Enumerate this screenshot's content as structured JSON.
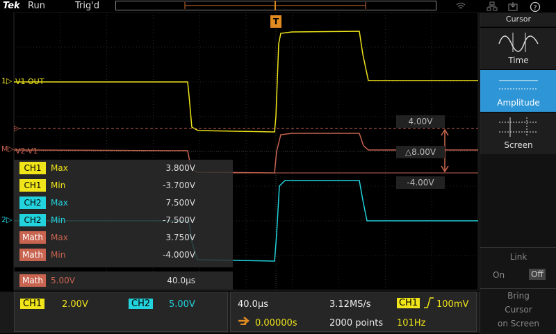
{
  "topbar": {
    "brand": "Tek",
    "run_state": "Run",
    "trigger_state": "Trig'd"
  },
  "colors": {
    "ch1": "#f0e41a",
    "ch2": "#22d3dd",
    "math": "#c86450",
    "panel_selected": "#2e96d6"
  },
  "icons": [
    "wifi-icon",
    "network-icon",
    "save-icon",
    "help-icon",
    "trigger-position-icon"
  ],
  "scope": {
    "ch1_label": "V1 OUT",
    "ch1_marker": "1",
    "ch2_marker": "2",
    "math_marker": "M",
    "math_label": "V2-V1",
    "trigger_label": "T",
    "cursor_top": "4.00V",
    "cursor_delta": "△8.00V",
    "cursor_bottom": "-4.00V"
  },
  "measurements": [
    {
      "source": "CH1",
      "name": "Max",
      "value": "3.800V"
    },
    {
      "source": "CH1",
      "name": "Min",
      "value": "-3.700V"
    },
    {
      "source": "CH2",
      "name": "Max",
      "value": "7.500V"
    },
    {
      "source": "CH2",
      "name": "Min",
      "value": "-7.500V"
    },
    {
      "source": "Math",
      "name": "Max",
      "value": "3.750V"
    },
    {
      "source": "Math",
      "name": "Min",
      "value": "-4.000V"
    }
  ],
  "math_setting": {
    "source": "Math",
    "scale": "5.00V",
    "time": "40.0µs"
  },
  "bottombar": {
    "ch1_label": "CH1",
    "ch1_scale": "2.00V",
    "ch2_label": "CH2",
    "ch2_scale": "5.00V",
    "horizontal_scale": "40.0µs",
    "sample_rate": "3.12MS/s",
    "trigger_source": "CH1",
    "trigger_level": "100mV",
    "position": "0.00000s",
    "record_length": "2000 points",
    "frequency": "101Hz"
  },
  "panel": {
    "title": "Cursor",
    "buttons": [
      {
        "label": "Time",
        "icon": "time-cursor-icon",
        "selected": false
      },
      {
        "label": "Amplitude",
        "icon": "amplitude-cursor-icon",
        "selected": true
      },
      {
        "label": "Screen",
        "icon": "screen-cursor-icon",
        "selected": false
      }
    ],
    "link_label": "Link",
    "link_on": "On",
    "link_off": "Off",
    "bring_line1": "Bring",
    "bring_line2": "Cursor",
    "bring_line3": "on Screen"
  }
}
